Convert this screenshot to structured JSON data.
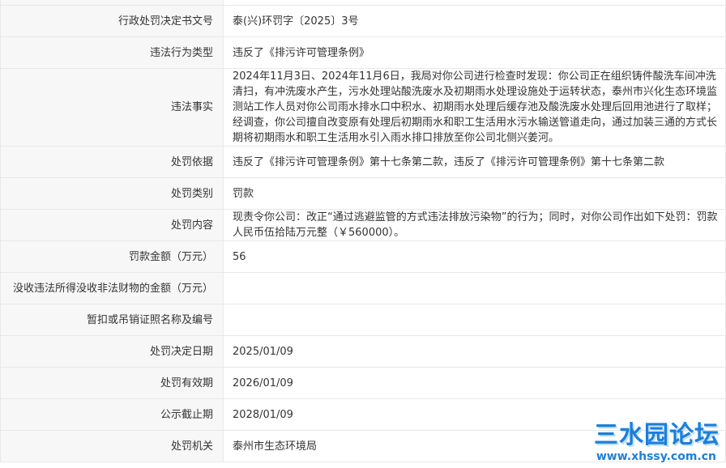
{
  "rows": [
    {
      "label": "行政处罚决定书文号",
      "value": "泰(兴)环罚字〔2025〕3号"
    },
    {
      "label": "违法行为类型",
      "value": "违反了《排污许可管理条例》"
    },
    {
      "label": "违法事实",
      "value": "2024年11月3日、2024年11月6日，我局对你公司进行检查时发现：你公司正在组织铸件酸洗车间冲洗清扫，有冲洗废水产生，污水处理站酸洗废水及初期雨水处理设施处于运转状态，泰州市兴化生态环境监测站工作人员对你公司雨水排水口中积水、初期雨水处理后缓存池及酸洗废水处理后回用池进行了取样；经调查，你公司擅自改变原有处理后初期雨水和职工生活用水污水输送管道走向，通过加装三通的方式长期将初期雨水和职工生活用水引入雨水排口排放至你公司北侧兴姜河。"
    },
    {
      "label": "处罚依据",
      "value": "违反了《排污许可管理条例》第十七条第二款，违反了《排污许可管理条例》第十七条第二款"
    },
    {
      "label": "处罚类别",
      "value": "罚款"
    },
    {
      "label": "处罚内容",
      "value": "现责令你公司：改正“通过逃避监管的方式违法排放污染物”的行为；同时，对你公司作出如下处罚：罚款人民币伍拾陆万元整（￥560000）。"
    },
    {
      "label": "罚款金额（万元）",
      "value": "56"
    },
    {
      "label": "没收违法所得没收非法财物的金额（万元）",
      "value": ""
    },
    {
      "label": "暂扣或吊销证照名称及编号",
      "value": ""
    },
    {
      "label": "处罚决定日期",
      "value": "2025/01/09"
    },
    {
      "label": "处罚有效期",
      "value": "2026/01/09"
    },
    {
      "label": "公示截止期",
      "value": "2028/01/09"
    },
    {
      "label": "处罚机关",
      "value": "泰州市生态环境局"
    }
  ],
  "watermark": {
    "logo": "三水园论坛",
    "url": "www.xhssy.com.cn"
  }
}
